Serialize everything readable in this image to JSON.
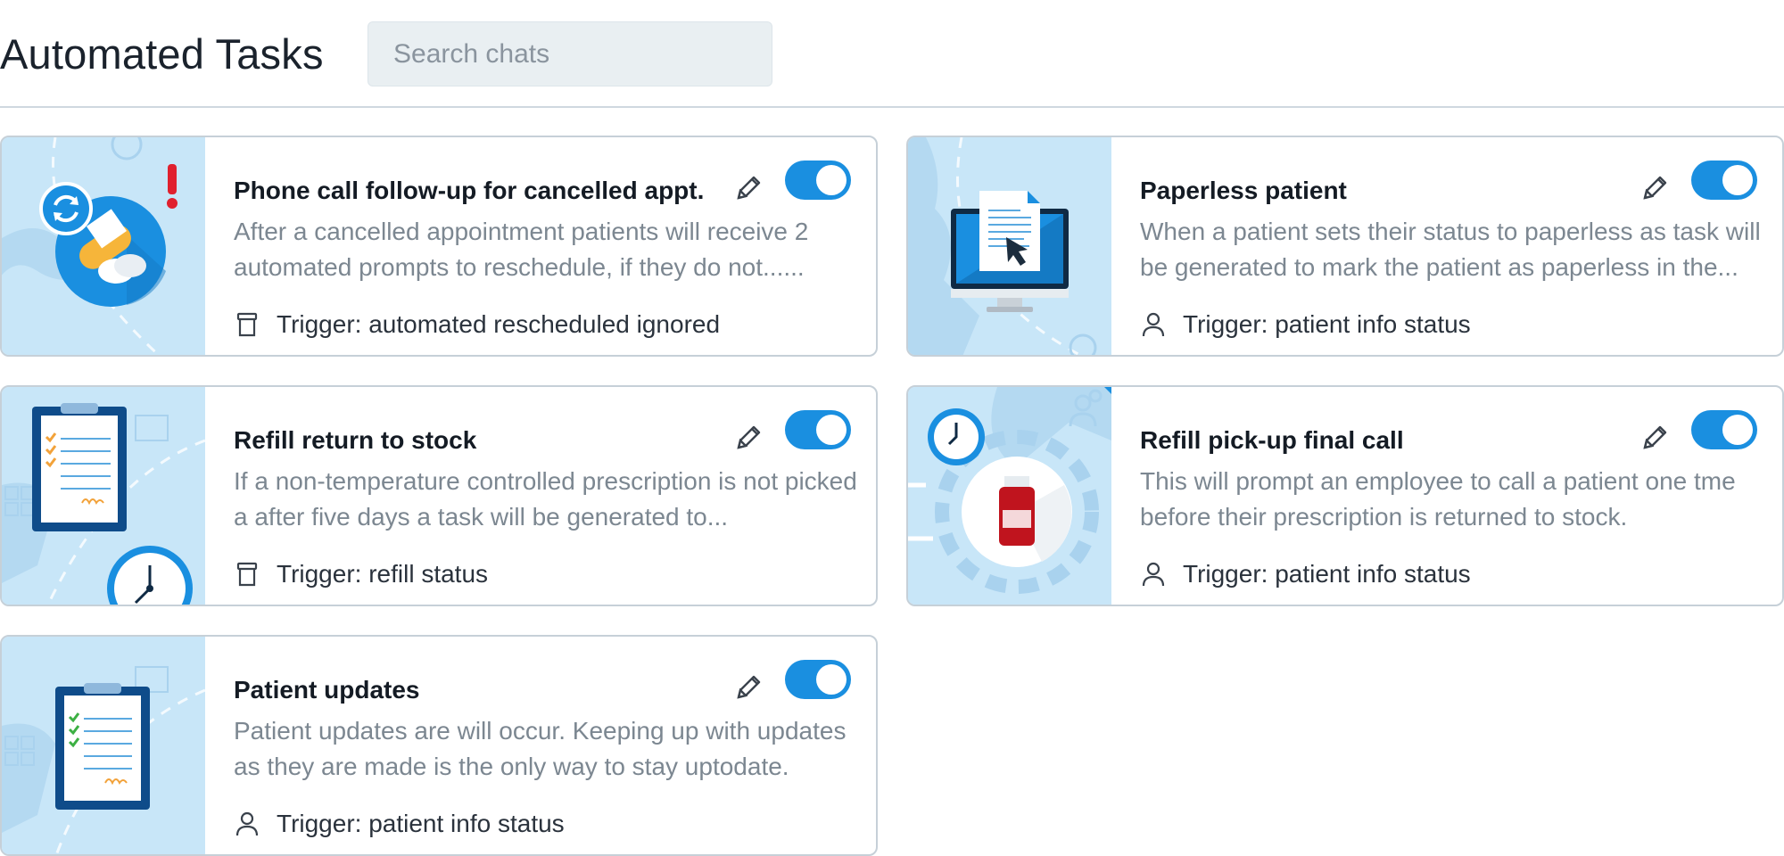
{
  "header": {
    "title": "Automated Tasks",
    "search_placeholder": "Search chats"
  },
  "colors": {
    "accent": "#1a8fe0",
    "illustration_bg": "#c8e6f8",
    "description_text": "#7c8791"
  },
  "cards": [
    {
      "title": "Phone call follow-up for cancelled appt.",
      "description": "After a cancelled appointment patients will receive 2 automated prompts to reschedule, if they do not......",
      "trigger": "Trigger: automated rescheduled ignored",
      "trigger_icon": "trash-can-icon",
      "illustration": "pills-alert-illustration",
      "enabled": true
    },
    {
      "title": "Paperless patient",
      "description": "When a patient sets their status to paperless as task will be generated to mark the patient as paperless in the...",
      "trigger": "Trigger: patient info status",
      "trigger_icon": "person-icon",
      "illustration": "computer-document-illustration",
      "enabled": true
    },
    {
      "title": "Refill return to stock",
      "description": "If a non-temperature controlled prescription is not picked a after five days a task will be generated to...",
      "trigger": "Trigger: refill status",
      "trigger_icon": "trash-can-icon",
      "illustration": "clipboard-clock-illustration",
      "enabled": true
    },
    {
      "title": "Refill pick-up final call",
      "description": "This will prompt an employee to call a patient one tme before their prescription is returned to stock.",
      "trigger": "Trigger: patient info status",
      "trigger_icon": "person-icon",
      "illustration": "medicine-bottle-clock-illustration",
      "enabled": true
    },
    {
      "title": "Patient updates",
      "description": "Patient updates are will occur. Keeping up with updates as they are made is the only way to stay uptodate.",
      "trigger": "Trigger: patient info status",
      "trigger_icon": "person-icon",
      "illustration": "clipboard-checklist-illustration",
      "enabled": true
    }
  ]
}
